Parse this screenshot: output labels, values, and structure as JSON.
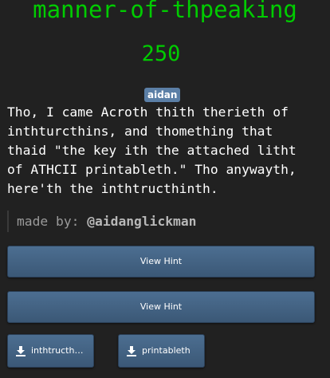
{
  "challenge": {
    "title": "manner-of-thpeaking",
    "points": "250",
    "category_badge": "aidan",
    "description": "Tho, I came Acroth thith therieth of\ninthturcthins, and thomething that\nthaid \"the key ith the attached litht\nof ATHCII printableth.\" Tho anywayth,\nhere'th the inthtructhinth.",
    "author_prefix": "made by: ",
    "author_handle": "@aidanglickman"
  },
  "hints": [
    {
      "label": "View Hint"
    },
    {
      "label": "View Hint"
    }
  ],
  "files": [
    {
      "label": "inthtructhinth",
      "icon": "download-icon"
    },
    {
      "label": "printableth",
      "icon": "download-icon"
    }
  ],
  "colors": {
    "background": "#212121",
    "accent_green": "#00cc00",
    "button": "#46668a",
    "badge": "#5b7fa6"
  }
}
